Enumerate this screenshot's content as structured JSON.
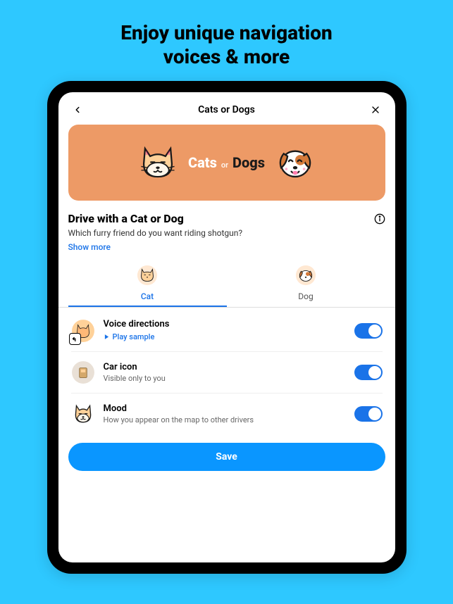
{
  "hero": {
    "line1": "Enjoy unique navigation",
    "line2": "voices & more"
  },
  "header": {
    "title": "Cats or Dogs"
  },
  "banner": {
    "cats": "Cats",
    "or": "or",
    "dogs": "Dogs"
  },
  "section": {
    "title": "Drive with a Cat or Dog",
    "subtitle": "Which furry friend do you want riding shotgun?",
    "show_more": "Show more"
  },
  "tabs": {
    "cat": "Cat",
    "dog": "Dog"
  },
  "settings": {
    "voice": {
      "title": "Voice directions",
      "play": "Play sample"
    },
    "car_icon": {
      "title": "Car icon",
      "subtitle": "Visible only to you"
    },
    "mood": {
      "title": "Mood",
      "subtitle": "How you appear on the map to other drivers"
    }
  },
  "save_label": "Save"
}
